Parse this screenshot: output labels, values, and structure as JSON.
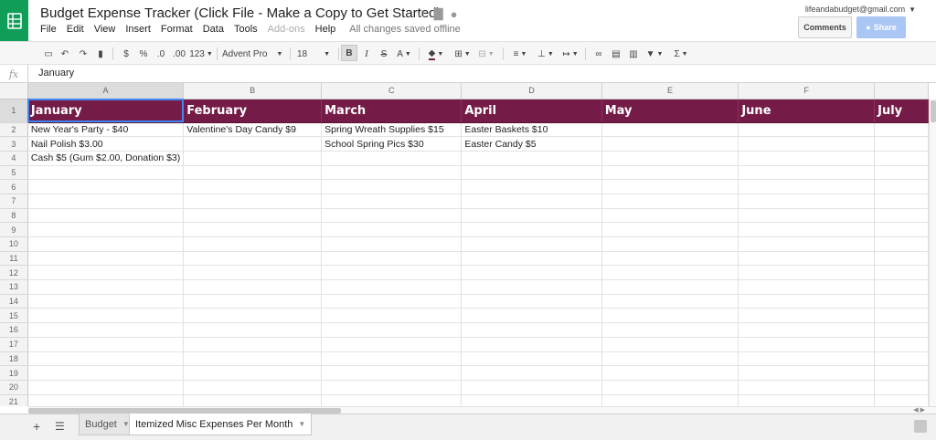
{
  "header": {
    "doc_title": "Budget Expense Tracker (Click File - Make a Copy to Get Started)",
    "account_email": "lifeandabudget@gmail.com",
    "comments_label": "Comments",
    "share_label": "Share",
    "menus": [
      "File",
      "Edit",
      "View",
      "Insert",
      "Format",
      "Data",
      "Tools",
      "Add-ons",
      "Help"
    ],
    "save_status": "All changes saved offline"
  },
  "toolbar": {
    "currency": "$",
    "percent": "%",
    "decrease_decimal": ".0",
    "increase_decimal": ".00",
    "more_formats": "123",
    "font": "Advent Pro",
    "font_size": "18",
    "bold": "B",
    "italic": "I",
    "strike": "S",
    "text_color": "A",
    "sum": "Σ"
  },
  "formula_bar": {
    "fx_label": "fx",
    "value": "January"
  },
  "grid": {
    "columns": [
      "A",
      "B",
      "C",
      "D",
      "E",
      "F",
      ""
    ],
    "header_row": [
      "January",
      "February",
      "March",
      "April",
      "May",
      "June",
      "July"
    ],
    "rows": [
      [
        "New Year's Party - $40",
        "Valentine's Day Candy $9",
        "Spring Wreath Supplies $15",
        "Easter Baskets $10",
        "",
        "",
        ""
      ],
      [
        "Nail Polish $3.00",
        "",
        "School Spring Pics $30",
        "Easter Candy $5",
        "",
        "",
        ""
      ],
      [
        "Cash $5 (Gum $2.00, Donation $3)",
        "",
        "",
        "",
        "",
        "",
        ""
      ]
    ],
    "row_numbers": [
      "1",
      "2",
      "3",
      "4",
      "5",
      "6",
      "7",
      "8",
      "9",
      "10",
      "11",
      "12",
      "13",
      "14",
      "15",
      "16",
      "17",
      "18",
      "19",
      "20",
      "21"
    ],
    "header_color": "#741b47"
  },
  "sheets": [
    {
      "label": "Budget",
      "active": false
    },
    {
      "label": "Itemized Misc Expenses Per Month",
      "active": true
    }
  ]
}
